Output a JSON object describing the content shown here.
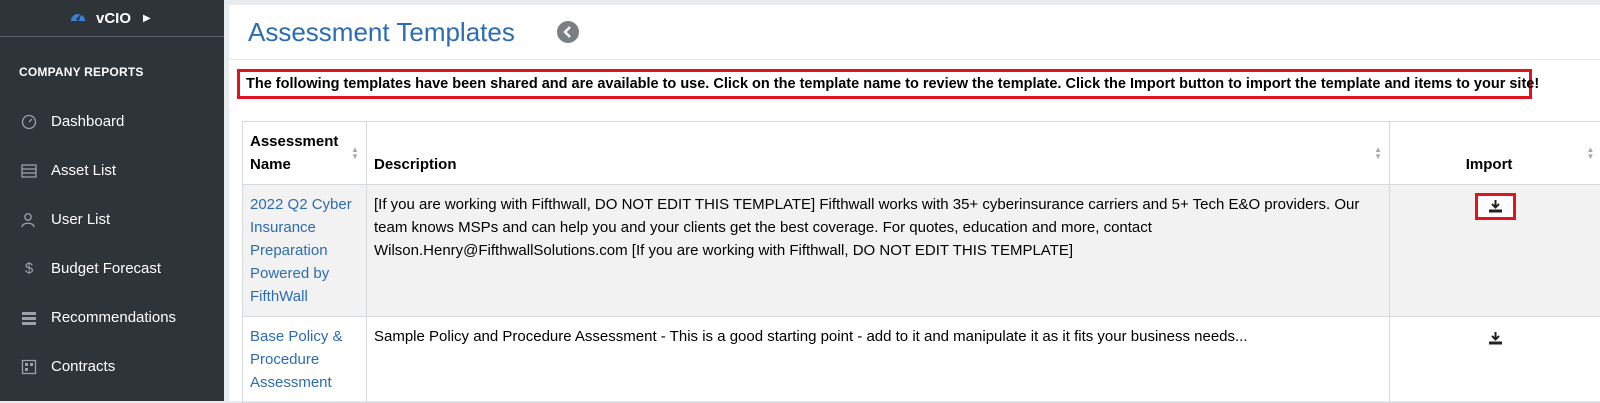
{
  "sidebar": {
    "app_name": "vCIO",
    "section": "COMPANY REPORTS",
    "items": [
      {
        "label": "Dashboard",
        "icon": "gauge-icon"
      },
      {
        "label": "Asset List",
        "icon": "list-icon"
      },
      {
        "label": "User List",
        "icon": "user-icon"
      },
      {
        "label": "Budget Forecast",
        "icon": "dollar-icon"
      },
      {
        "label": "Recommendations",
        "icon": "stack-icon"
      },
      {
        "label": "Contracts",
        "icon": "calendar-icon"
      }
    ]
  },
  "header": {
    "title": "Assessment Templates"
  },
  "notice": "The following templates have been shared and are available to use. Click on the template name to review the template. Click the Import button to import the template and items to your site!",
  "table": {
    "columns": [
      "Assessment Name",
      "Description",
      "Import"
    ],
    "rows": [
      {
        "name": "2022 Q2 Cyber Insurance Preparation Powered by FifthWall",
        "description": "[If you are working with Fifthwall, DO NOT EDIT THIS TEMPLATE] Fifthwall works with 35+ cyberinsurance carriers and 5+ Tech E&O providers. Our team knows MSPs and can help you and your clients get the best coverage. For quotes, education and more, contact Wilson.Henry@FifthwallSolutions.com [If you are working with Fifthwall, DO NOT EDIT THIS TEMPLATE]"
      },
      {
        "name": "Base Policy & Procedure Assessment",
        "description": "Sample Policy and Procedure Assessment - This is a good starting point - add to it and manipulate it as it fits your business needs..."
      }
    ]
  },
  "colors": {
    "sidebar_bg": "#2f3439",
    "link": "#2b6cb3",
    "highlight": "#e0141e"
  }
}
